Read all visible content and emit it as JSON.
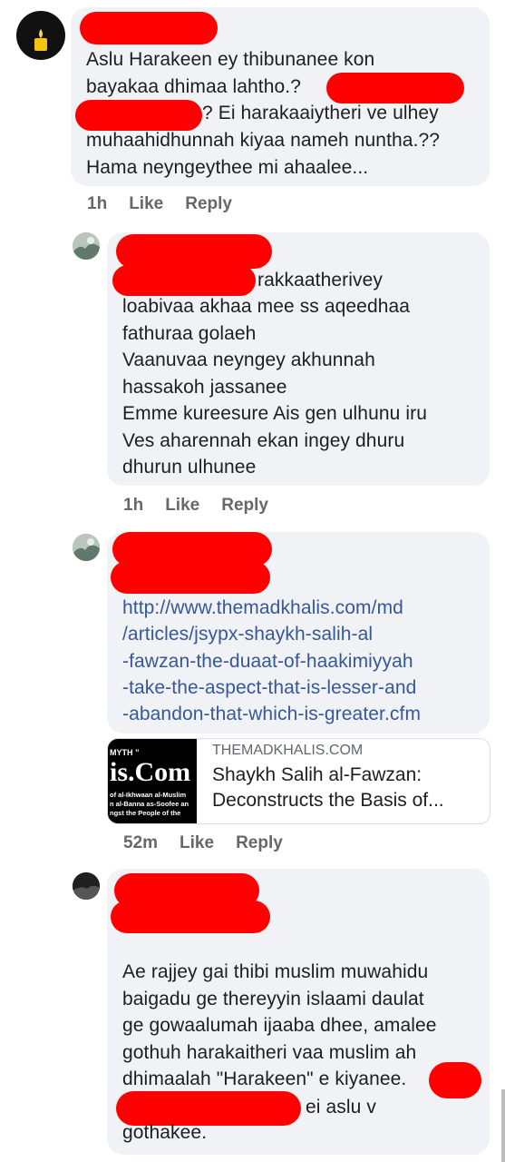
{
  "comments": [
    {
      "text_lines": [
        "Aslu Harakeen ey thibunanee kon",
        "bayakaa dhimaa lahtho.?",
        "? Ei harakaaiytheri ve ulhey",
        "muhaahidhunnah kiyaa nameh nuntha.??",
        "Hama neyngeythee mi ahaalee..."
      ],
      "time": "1h",
      "like": "Like",
      "reply": "Reply"
    },
    {
      "text_lines": [
        "rakkaatherivey",
        "loabivaa akhaa mee ss aqeedhaa",
        "fathuraa golaeh",
        "Vaanuvaa neyngey akhunnah",
        "hassakoh jassanee",
        "Emme kureesure Ais gen ulhunu iru",
        "Ves aharennah ekan ingey dhuru",
        "dhurun ulhunee"
      ],
      "time": "1h",
      "like": "Like",
      "reply": "Reply"
    },
    {
      "link_lines": [
        "http://www.themadkhalis.com/md",
        "/articles/jsypx-shaykh-salih-al",
        "-fawzan-the-duaat-of-haakimiyyah",
        "-take-the-aspect-that-is-lesser-and",
        "-abandon-that-which-is-greater.cfm"
      ],
      "preview": {
        "domain": "THEMADKHALIS.COM",
        "title_lines": [
          "Shaykh Salih al-Fawzan:",
          "Deconstructs the Basis of..."
        ],
        "thumb_lines": [
          "MYTH ”",
          "is.Com",
          "of al-Ikhwaan al-Muslim",
          "n al-Banna as-Soofee an",
          "ngst the People of the"
        ]
      },
      "time": "52m",
      "like": "Like",
      "reply": "Reply"
    },
    {
      "text_lines": [
        "Ae rajjey gai thibi muslim muwahidu",
        "baigadu ge thereyyin islaami daulat",
        "ge gowaalumah ijaaba dhee, amalee",
        "gothuh harakaitheri vaa muslim ah",
        "dhimaalah \"Harakeen\" e kiyanee.",
        "ei aslu v",
        "gothakee."
      ]
    }
  ],
  "colors": {
    "bubble": "#f0f2f5",
    "link": "#365899",
    "redaction": "#ff0000",
    "action": "#65676b"
  }
}
